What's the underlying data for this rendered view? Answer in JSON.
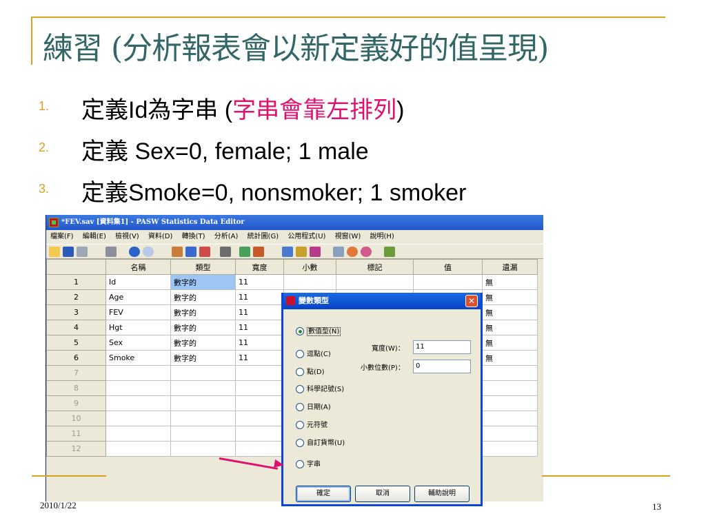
{
  "slide": {
    "title": "練習 (分析報表會以新定義好的值呈現)",
    "bullets": [
      {
        "num": "1.",
        "text_a": "定義Id為字串 (",
        "text_red": "字串會靠左排列",
        "text_b": ")"
      },
      {
        "num": "2.",
        "text": "定義 Sex=0, female; 1 male"
      },
      {
        "num": "3.",
        "text": "定義Smoke=0, nonsmoker; 1 smoker"
      }
    ],
    "date": "2010/1/22",
    "page_number": "13",
    "accent_color": "#d6a21f",
    "title_color": "#336666",
    "highlight_color": "#e0106e"
  },
  "window": {
    "title": "*FEV.sav [資料集1] - PASW Statistics Data Editor",
    "menu": [
      "檔案(F)",
      "編輯(E)",
      "檢視(V)",
      "資料(D)",
      "轉換(T)",
      "分析(A)",
      "統計圖(G)",
      "公用程式(U)",
      "視窗(W)",
      "說明(H)"
    ],
    "toolbar_icons": [
      "open-icon",
      "save-icon",
      "print-icon",
      "dialog-recall-icon",
      "undo-icon",
      "redo-icon",
      "goto-case-icon",
      "goto-variable-icon",
      "variables-icon",
      "find-icon",
      "insert-cases-icon",
      "insert-variable-icon",
      "split-file-icon",
      "weight-cases-icon",
      "select-cases-icon",
      "value-labels-icon",
      "use-sets-icon",
      "show-all-icon",
      "spell-check-icon"
    ],
    "columns": [
      "名稱",
      "類型",
      "寬度",
      "小數",
      "標記",
      "值",
      "遺漏"
    ],
    "rows": [
      {
        "n": "1",
        "name": "Id",
        "type": "數字的",
        "width": "11",
        "missing": "無"
      },
      {
        "n": "2",
        "name": "Age",
        "type": "數字的",
        "width": "11",
        "missing": "無"
      },
      {
        "n": "3",
        "name": "FEV",
        "type": "數字的",
        "width": "11",
        "missing": "無"
      },
      {
        "n": "4",
        "name": "Hgt",
        "type": "數字的",
        "width": "11",
        "missing": "無"
      },
      {
        "n": "5",
        "name": "Sex",
        "type": "數字的",
        "width": "11",
        "missing": "無"
      },
      {
        "n": "6",
        "name": "Smoke",
        "type": "數字的",
        "width": "11",
        "missing": "無"
      }
    ],
    "empty_rows": [
      "7",
      "8",
      "9",
      "10",
      "11",
      "12"
    ]
  },
  "dialog": {
    "title": "變數類型",
    "close": "✕",
    "options": [
      "數值型(N)",
      "逗點(C)",
      "點(D)",
      "科學記號(S)",
      "日期(A)",
      "元符號",
      "自訂貨幣(U)",
      "字串"
    ],
    "selected": "數值型(N)",
    "width_label": "寬度(W)：",
    "width_value": "11",
    "decimals_label": "小數位數(P)：",
    "decimals_value": "0",
    "buttons": {
      "ok": "確定",
      "cancel": "取消",
      "help": "輔助說明"
    }
  }
}
